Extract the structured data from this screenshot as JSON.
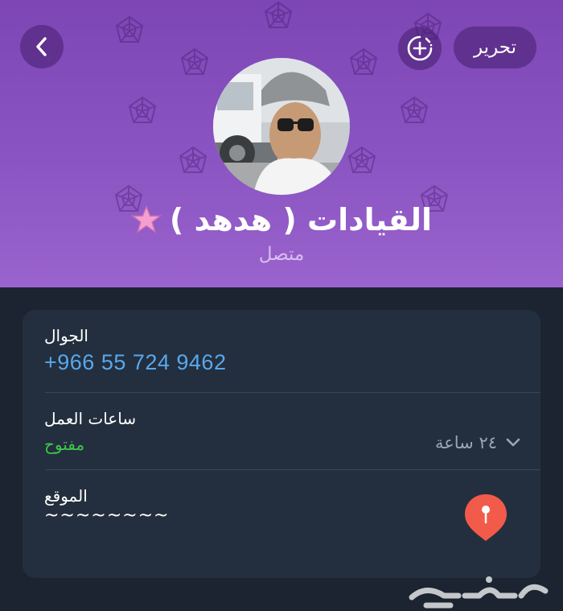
{
  "header": {
    "back_icon": "chevron-left-icon",
    "add_story_icon": "circle-plus-icon",
    "edit_label": "تحرير",
    "name": "القيادات ( هدهد )",
    "name_emoji": "star-icon",
    "status": "متصل",
    "colors": {
      "gradient_top": "#7d46b4",
      "gradient_bottom": "#9a63cd",
      "status": "#d8bdf0"
    }
  },
  "info": {
    "mobile_label": "الجوال",
    "mobile_value": "+966 55 724 9462",
    "hours_label": "ساعات العمل",
    "hours_status": "مفتوح",
    "hours_value": "٢٤ ساعة",
    "location_label": "الموقع",
    "location_value": "~~~~~~~~",
    "pin_icon": "location-pin-icon",
    "colors": {
      "link": "#58a8ee",
      "open": "#3ec94a",
      "pin": "#f25a4a"
    }
  },
  "watermark": {
    "icon": "haraj-logo"
  }
}
